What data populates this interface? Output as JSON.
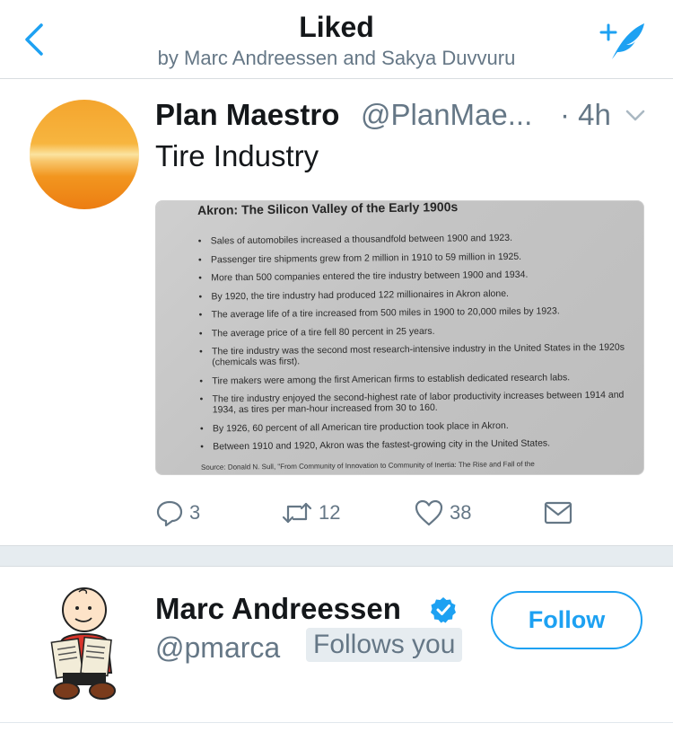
{
  "header": {
    "title": "Liked",
    "subtitle": "by Marc Andreessen and Sakya Duvvuru",
    "accent_color": "#1da1f2",
    "back_icon": "chevron-left-icon",
    "compose_icon": "compose-tweet-icon"
  },
  "tweet": {
    "author_name": "Plan Maestro",
    "author_handle": "@PlanMae...",
    "time": "· 4h",
    "text": "Tire Industry",
    "image": {
      "title": "Akron: The Silicon Valley of the Early 1900s",
      "bullets": [
        "Sales of automobiles increased a thousandfold between 1900 and 1923.",
        "Passenger tire shipments grew from 2 million in 1910 to 59 million in 1925.",
        "More than 500 companies entered the tire industry between 1900 and 1934.",
        "By 1920, the tire industry had produced 122 millionaires in Akron alone.",
        "The average life of a tire increased from 500 miles in 1900 to 20,000 miles by 1923.",
        "The average price of a tire fell 80 percent in 25 years.",
        "The tire industry was the second most research-intensive industry in the United States in the 1920s (chemicals was first).",
        "Tire makers were among the first American firms to establish dedicated research labs.",
        "The tire industry enjoyed the second-highest rate of labor productivity increases between 1914 and 1934, as tires per man-hour increased from 30 to 160.",
        "By 1926, 60 percent of all American tire production took place in Akron.",
        "Between 1910 and 1920, Akron was the fastest-growing city in the United States."
      ],
      "source": "Source: Donald N. Sull, \"From Community of Innovation to Community of Inertia: The Rise and Fall of the"
    },
    "actions": {
      "replies": "3",
      "retweets": "12",
      "likes": "38"
    }
  },
  "user": {
    "name": "Marc Andreessen",
    "handle": "@pmarca",
    "follows_badge": "Follows you",
    "follow_label": "Follow",
    "verified_icon": "verified-badge-icon"
  }
}
